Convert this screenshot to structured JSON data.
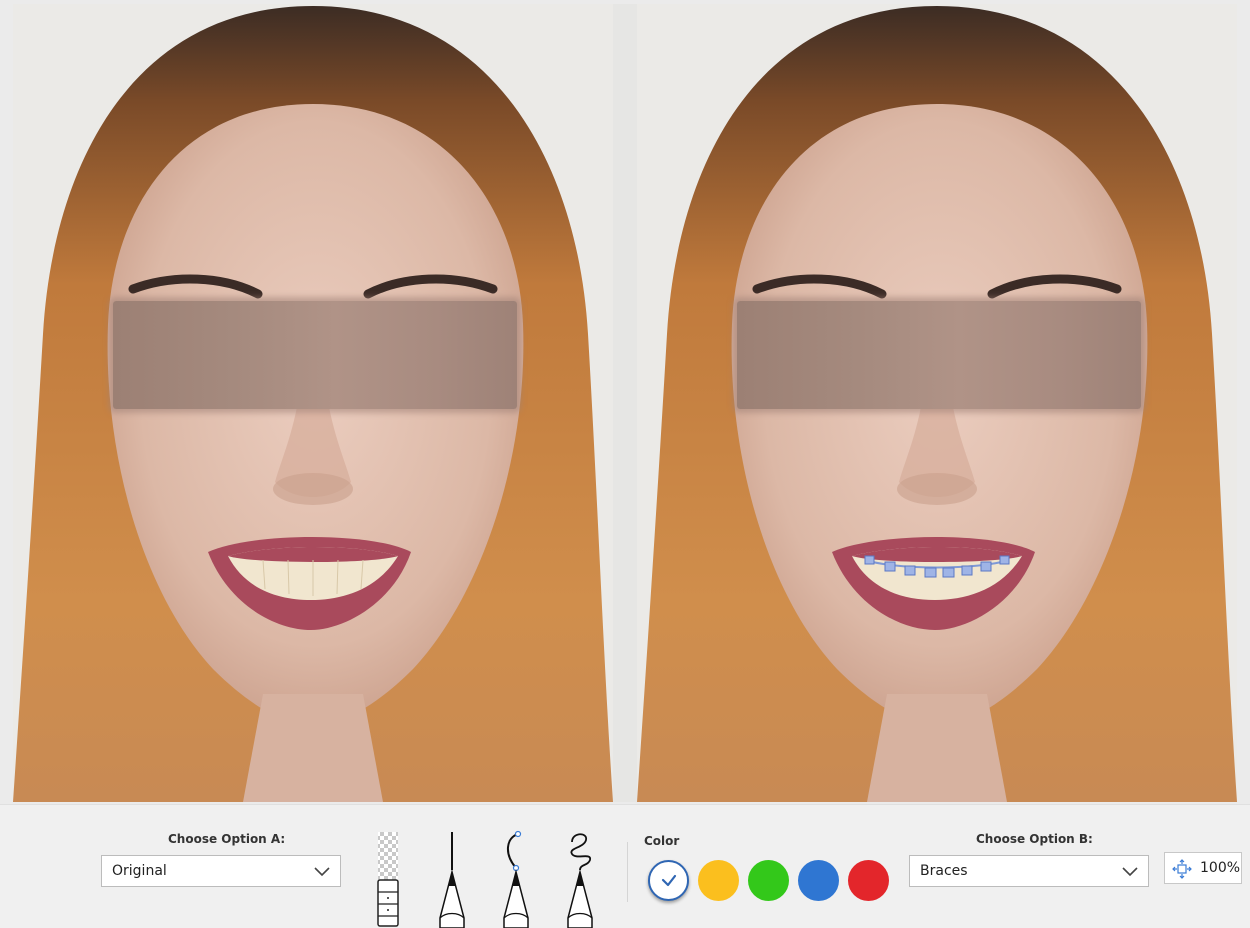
{
  "option_a": {
    "label": "Choose Option A:",
    "value": "Original"
  },
  "option_b": {
    "label": "Choose Option B:",
    "value": "Braces"
  },
  "color": {
    "label": "Color",
    "swatches": [
      {
        "name": "white",
        "hex": "#ffffff",
        "selected": true
      },
      {
        "name": "yellow",
        "hex": "#fbbf1e",
        "selected": false
      },
      {
        "name": "green",
        "hex": "#33c81a",
        "selected": false
      },
      {
        "name": "blue",
        "hex": "#2f76d2",
        "selected": false
      },
      {
        "name": "red",
        "hex": "#e3262b",
        "selected": false
      }
    ]
  },
  "tools": [
    "eraser-icon",
    "pencil-line-icon",
    "pencil-curve-icon",
    "pencil-freehand-icon"
  ],
  "zoom": {
    "value": "100%",
    "icon": "fit-screen-icon"
  },
  "images": {
    "a": "original-smile-photo",
    "b": "braces-preview-photo"
  }
}
